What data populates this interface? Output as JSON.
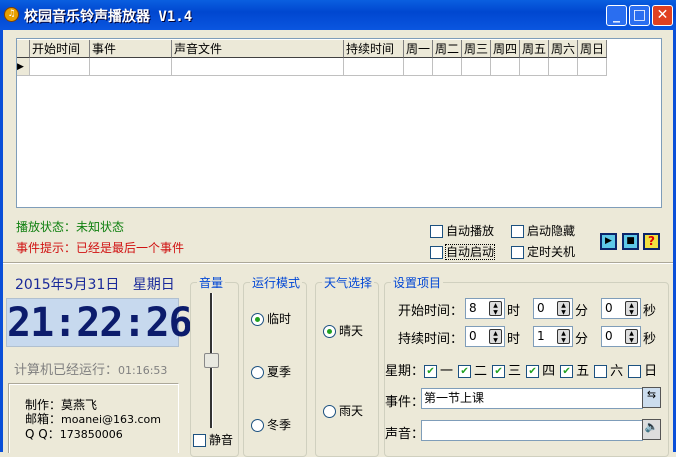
{
  "window": {
    "title": "校园音乐铃声播放器 V1.4"
  },
  "grid": {
    "columns": [
      "开始时间",
      "事件",
      "声音文件",
      "持续时间",
      "周一",
      "周二",
      "周三",
      "周四",
      "周五",
      "周六",
      "周日"
    ]
  },
  "status": {
    "play_label": "播放状态：",
    "play_value": "未知状态",
    "event_label": "事件提示：",
    "event_value": "已经是最后一个事件"
  },
  "options": {
    "auto_play": "自动播放",
    "start_hidden": "启动隐藏",
    "auto_start": "自动启动",
    "timed_shutdown": "定时关机"
  },
  "clock": {
    "date": "2015年5月31日",
    "weekday": "星期日",
    "time": "21:22:26",
    "uptime_label": "计算机已经运行：",
    "uptime": "01:16:53"
  },
  "info": {
    "author_label": "制作：",
    "author": "莫燕飞",
    "email_label": "邮箱：",
    "email": "moanei@163.com",
    "qq_label": "Q Q：",
    "qq": "173850006"
  },
  "volume": {
    "title": "音量",
    "mute": "静音",
    "level": 0.5
  },
  "mode": {
    "title": "运行模式",
    "options": [
      "临时",
      "夏季",
      "冬季"
    ],
    "selected": "临时"
  },
  "weather": {
    "title": "天气选择",
    "options": [
      "晴天",
      "雨天"
    ],
    "selected": "晴天"
  },
  "settings": {
    "title": "设置项目",
    "start_label": "开始时间：",
    "duration_label": "持续时间：",
    "start": [
      "8",
      "0",
      "0"
    ],
    "duration": [
      "0",
      "1",
      "0"
    ],
    "units": [
      "时",
      "分",
      "秒"
    ],
    "week_label": "星期：",
    "days": [
      "一",
      "二",
      "三",
      "四",
      "五",
      "六",
      "日"
    ],
    "days_checked": [
      true,
      true,
      true,
      true,
      true,
      false,
      false
    ],
    "event_label": "事件：",
    "event_value": "第一节上课",
    "sound_label": "声音：",
    "sound_value": ""
  }
}
